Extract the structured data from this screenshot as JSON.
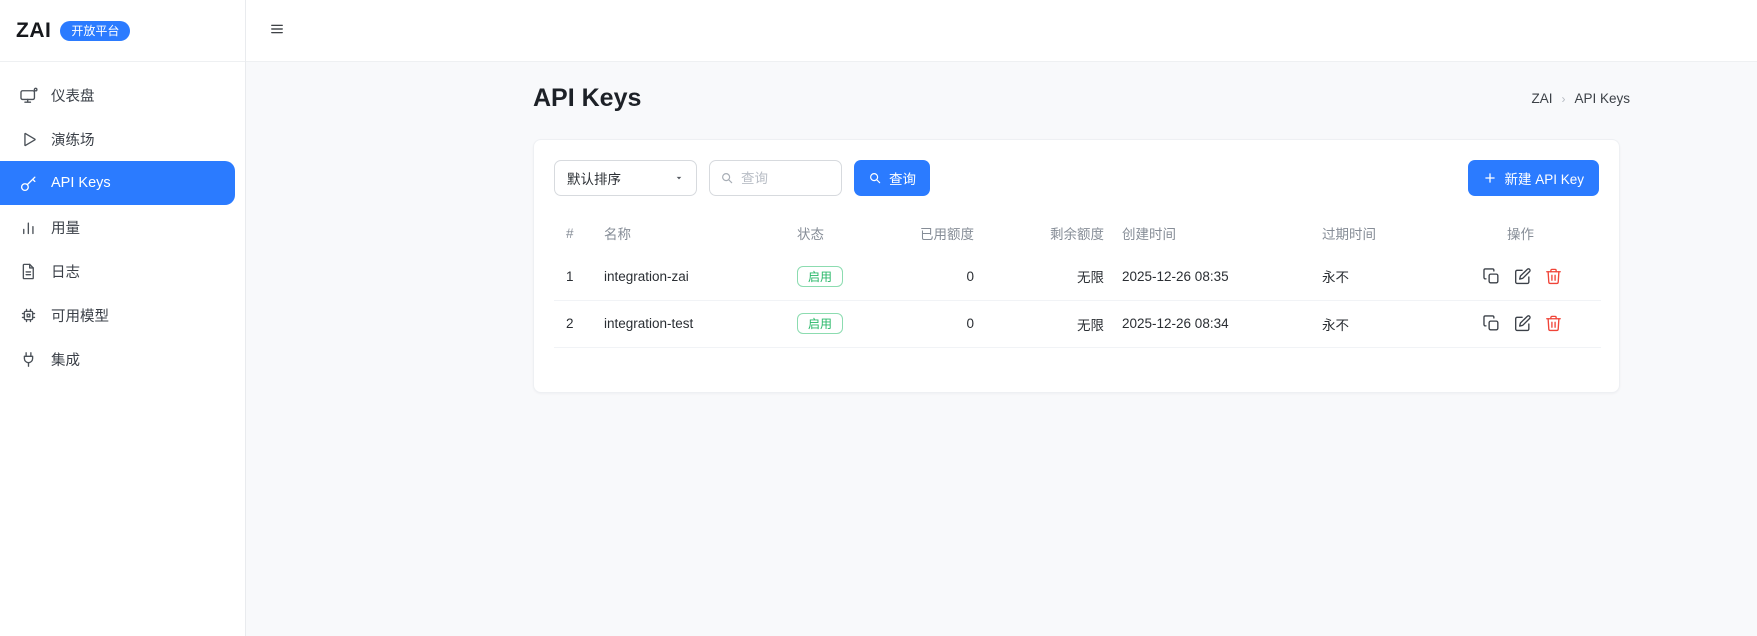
{
  "brand": {
    "name": "ZAI",
    "badge": "开放平台"
  },
  "sidebar": {
    "items": [
      {
        "id": "dashboard",
        "label": "仪表盘",
        "icon": "dashboard",
        "active": false
      },
      {
        "id": "playground",
        "label": "演练场",
        "icon": "play",
        "active": false
      },
      {
        "id": "api-keys",
        "label": "API Keys",
        "icon": "key",
        "active": true
      },
      {
        "id": "usage",
        "label": "用量",
        "icon": "bar-chart",
        "active": false
      },
      {
        "id": "logs",
        "label": "日志",
        "icon": "document",
        "active": false
      },
      {
        "id": "models",
        "label": "可用模型",
        "icon": "chip",
        "active": false
      },
      {
        "id": "integration",
        "label": "集成",
        "icon": "plug",
        "active": false
      }
    ]
  },
  "page": {
    "title": "API Keys",
    "breadcrumb": [
      "ZAI",
      "API Keys"
    ]
  },
  "toolbar": {
    "sort_selected": "默认排序",
    "search_placeholder": "查询",
    "search_button_label": "查询",
    "create_button_label": "新建 API Key"
  },
  "table": {
    "headers": [
      "#",
      "名称",
      "状态",
      "已用额度",
      "剩余额度",
      "创建时间",
      "过期时间",
      "操作"
    ],
    "rows": [
      {
        "index": "1",
        "name": "integration-zai",
        "status": "启用",
        "used": "0",
        "remaining": "无限",
        "created": "2025-12-26 08:35",
        "expires": "永不"
      },
      {
        "index": "2",
        "name": "integration-test",
        "status": "启用",
        "used": "0",
        "remaining": "无限",
        "created": "2025-12-26 08:34",
        "expires": "永不"
      }
    ]
  },
  "colors": {
    "primary": "#2b7bff",
    "success": "#29b869",
    "danger": "#f04438"
  }
}
